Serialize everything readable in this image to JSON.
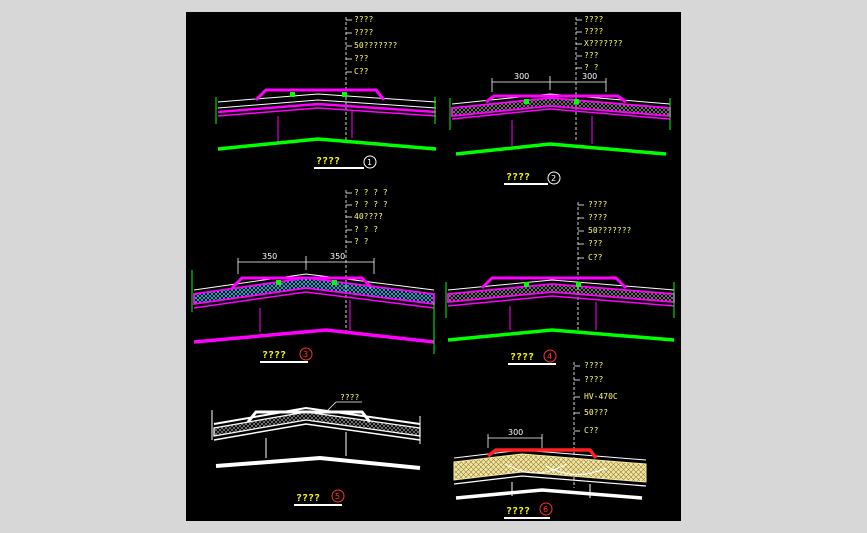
{
  "colors": {
    "sheet": "#000000",
    "bg": "#d7d7d7",
    "magenta": "#ff00ff",
    "green": "#00ff00",
    "yellow": "#ffff00",
    "white": "#ffffff",
    "cyan": "#44ccff",
    "red": "#ff2020",
    "sand": "#f5e79e",
    "ring_red": "#ff3030"
  },
  "details": [
    {
      "title": "????",
      "number": "1",
      "labels": [
        "????",
        "????",
        "50???????",
        "???",
        "C??"
      ]
    },
    {
      "title": "????",
      "number": "2",
      "labels": [
        "????",
        "????",
        "X???????",
        "???",
        "? ?"
      ],
      "dims": [
        "300",
        "300"
      ]
    },
    {
      "title": "????",
      "number": "3",
      "labels": [
        "? ? ? ?",
        "? ? ? ?",
        "40????",
        "? ? ?",
        "? ?"
      ],
      "dims": [
        "350",
        "350"
      ]
    },
    {
      "title": "????",
      "number": "4",
      "labels": [
        "????",
        "????",
        "50???????",
        "???",
        "C??"
      ]
    },
    {
      "title": "????",
      "number": "5",
      "labels": [
        "????"
      ]
    },
    {
      "title": "????",
      "number": "6",
      "labels": [
        "????",
        "????",
        "HV-470C",
        "50???",
        "C??"
      ],
      "dims": [
        "300"
      ]
    }
  ]
}
